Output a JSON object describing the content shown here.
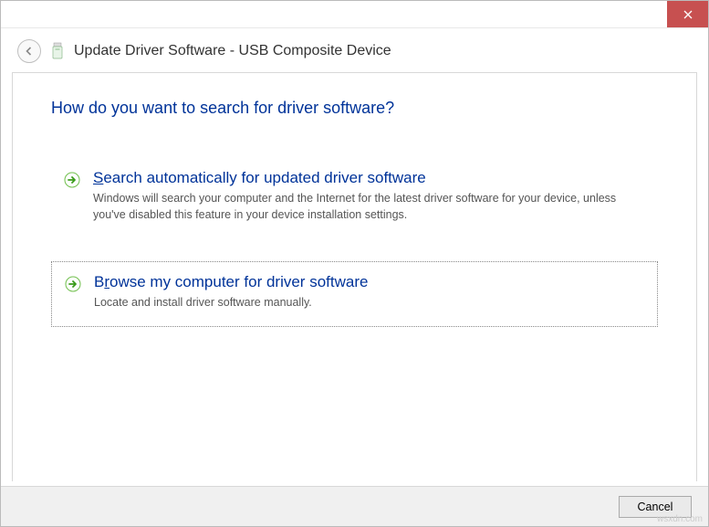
{
  "window": {
    "title": "Update Driver Software - USB Composite Device"
  },
  "main": {
    "heading": "How do you want to search for driver software?",
    "options": [
      {
        "accel": "S",
        "title_rest": "earch automatically for updated driver software",
        "description": "Windows will search your computer and the Internet for the latest driver software for your device, unless you've disabled this feature in your device installation settings."
      },
      {
        "accel": "r",
        "title_pre": "B",
        "title_rest": "owse my computer for driver software",
        "description": "Locate and install driver software manually."
      }
    ]
  },
  "footer": {
    "cancel_label": "Cancel"
  },
  "watermark": "wsxdn.com"
}
